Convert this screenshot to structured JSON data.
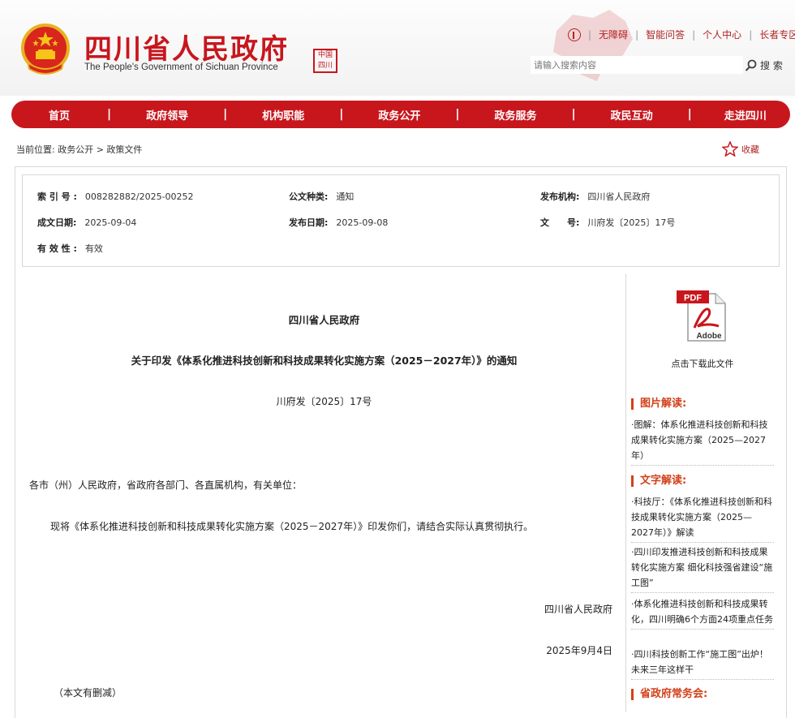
{
  "header": {
    "site_title_cn": "四川省人民政府",
    "site_title_en": "The People's Government of Sichuan Province",
    "seal_text": "中国四川",
    "top_links": [
      "无障碍",
      "智能问答",
      "个人中心",
      "长者专区"
    ],
    "search_placeholder": "请输入搜索内容",
    "search_label": "搜 索"
  },
  "nav": {
    "items": [
      "首页",
      "政府领导",
      "机构职能",
      "政务公开",
      "政务服务",
      "政民互动",
      "走进四川"
    ]
  },
  "breadcrumb": {
    "prefix": "当前位置:",
    "path": "政务公开 > 政策文件"
  },
  "favorite_label": "收藏",
  "meta": {
    "index_no_label": "索 引 号 :",
    "index_no": "008282882/2025-00252",
    "doc_type_label": "公文种类:",
    "doc_type": "通知",
    "issuer_label": "发布机构:",
    "issuer": "四川省人民政府",
    "created_label": "成文日期:",
    "created": "2025-09-04",
    "published_label": "发布日期:",
    "published": "2025-09-08",
    "doc_no_label": "文　　号:",
    "doc_no": "川府发〔2025〕17号",
    "validity_label": "有 效 性 :",
    "validity": "有效"
  },
  "document": {
    "issuer": "四川省人民政府",
    "title": "关于印发《体系化推进科技创新和科技成果转化实施方案（2025－2027年）》的通知",
    "number": "川府发〔2025〕17号",
    "salutation": "各市（州）人民政府，省政府各部门、各直属机构，有关单位：",
    "body": "现将《体系化推进科技创新和科技成果转化实施方案（2025－2027年）》印发你们，请结合实际认真贯彻执行。",
    "signature": "四川省人民政府",
    "date": "2025年9月4日",
    "note": "（本文有删减）"
  },
  "sidebar": {
    "pdf_label": "PDF",
    "pdf_brand": "Adobe",
    "download_label": "点击下载此文件",
    "picture_section": "图片解读:",
    "picture_links": [
      "·图解：体系化推进科技创新和科技成果转化实施方案（2025—2027年）"
    ],
    "text_section": "文字解读:",
    "text_links": [
      "·科技厅：《体系化推进科技创新和科技成果转化实施方案（2025—2027年）》解读",
      "·四川印发推进科技创新和科技成果转化实施方案 细化科技强省建设“施工图”",
      "·体系化推进科技创新和科技成果转化，四川明确6个方面24项重点任务",
      "·四川科技创新工作“施工图”出炉！未来三年这样干"
    ],
    "meeting_section": "省政府常务会:"
  },
  "colors": {
    "brand_red": "#c8161d",
    "section_orange": "#d2401a"
  }
}
